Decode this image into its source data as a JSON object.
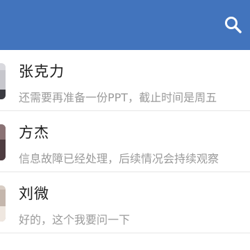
{
  "header": {
    "search_icon": "search-icon",
    "color": "#4274bd"
  },
  "chats": [
    {
      "name": "张克力",
      "preview": "还需要再准备一份PPT，截止时间是周五",
      "avatar_color": "#d9d9de"
    },
    {
      "name": "方杰",
      "preview": "信息故障已经处理，后续情况会持续观察",
      "avatar_color": "#6b5458"
    },
    {
      "name": "刘微",
      "preview": "好的，这个我要问一下",
      "avatar_color": "#d8cdc4"
    }
  ]
}
